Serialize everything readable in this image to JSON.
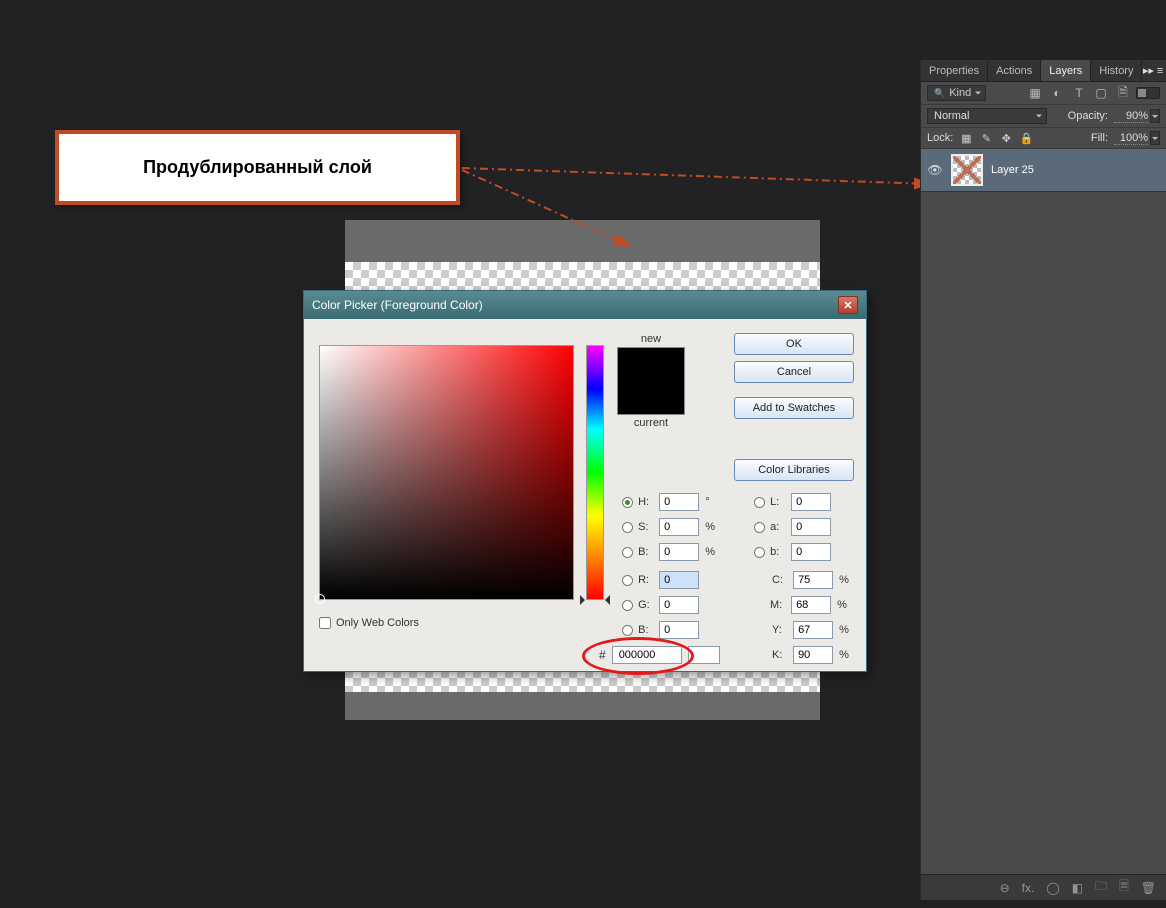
{
  "annotation": {
    "text": "Продублированный слой"
  },
  "panel": {
    "tabs": {
      "properties": "Properties",
      "actions": "Actions",
      "layers": "Layers",
      "history": "History"
    },
    "kind": "Kind",
    "blend_mode": "Normal",
    "opacity_label": "Opacity:",
    "opacity_value": "90%",
    "lock_label": "Lock:",
    "fill_label": "Fill:",
    "fill_value": "100%",
    "layer": {
      "name": "Layer 25"
    },
    "footer_icons": [
      "⊖",
      "fx.",
      "◯",
      "◧",
      "🗀",
      "🗏",
      "🗑"
    ]
  },
  "dialog": {
    "title": "Color Picker (Foreground Color)",
    "new_label": "new",
    "current_label": "current",
    "only_web": "Only Web Colors",
    "buttons": {
      "ok": "OK",
      "cancel": "Cancel",
      "add": "Add to Swatches",
      "libs": "Color Libraries"
    },
    "fields": {
      "H": {
        "label": "H:",
        "value": "0",
        "unit": "°"
      },
      "S": {
        "label": "S:",
        "value": "0",
        "unit": "%"
      },
      "Bv": {
        "label": "B:",
        "value": "0",
        "unit": "%"
      },
      "R": {
        "label": "R:",
        "value": "0",
        "unit": ""
      },
      "G": {
        "label": "G:",
        "value": "0",
        "unit": ""
      },
      "Bc": {
        "label": "B:",
        "value": "0",
        "unit": ""
      },
      "L": {
        "label": "L:",
        "value": "0",
        "unit": ""
      },
      "a": {
        "label": "a:",
        "value": "0",
        "unit": ""
      },
      "b": {
        "label": "b:",
        "value": "0",
        "unit": ""
      },
      "C": {
        "label": "C:",
        "value": "75",
        "unit": "%"
      },
      "M": {
        "label": "M:",
        "value": "68",
        "unit": "%"
      },
      "Y": {
        "label": "Y:",
        "value": "67",
        "unit": "%"
      },
      "K": {
        "label": "K:",
        "value": "90",
        "unit": "%"
      }
    },
    "hex": {
      "hash": "#",
      "value": "000000"
    }
  }
}
